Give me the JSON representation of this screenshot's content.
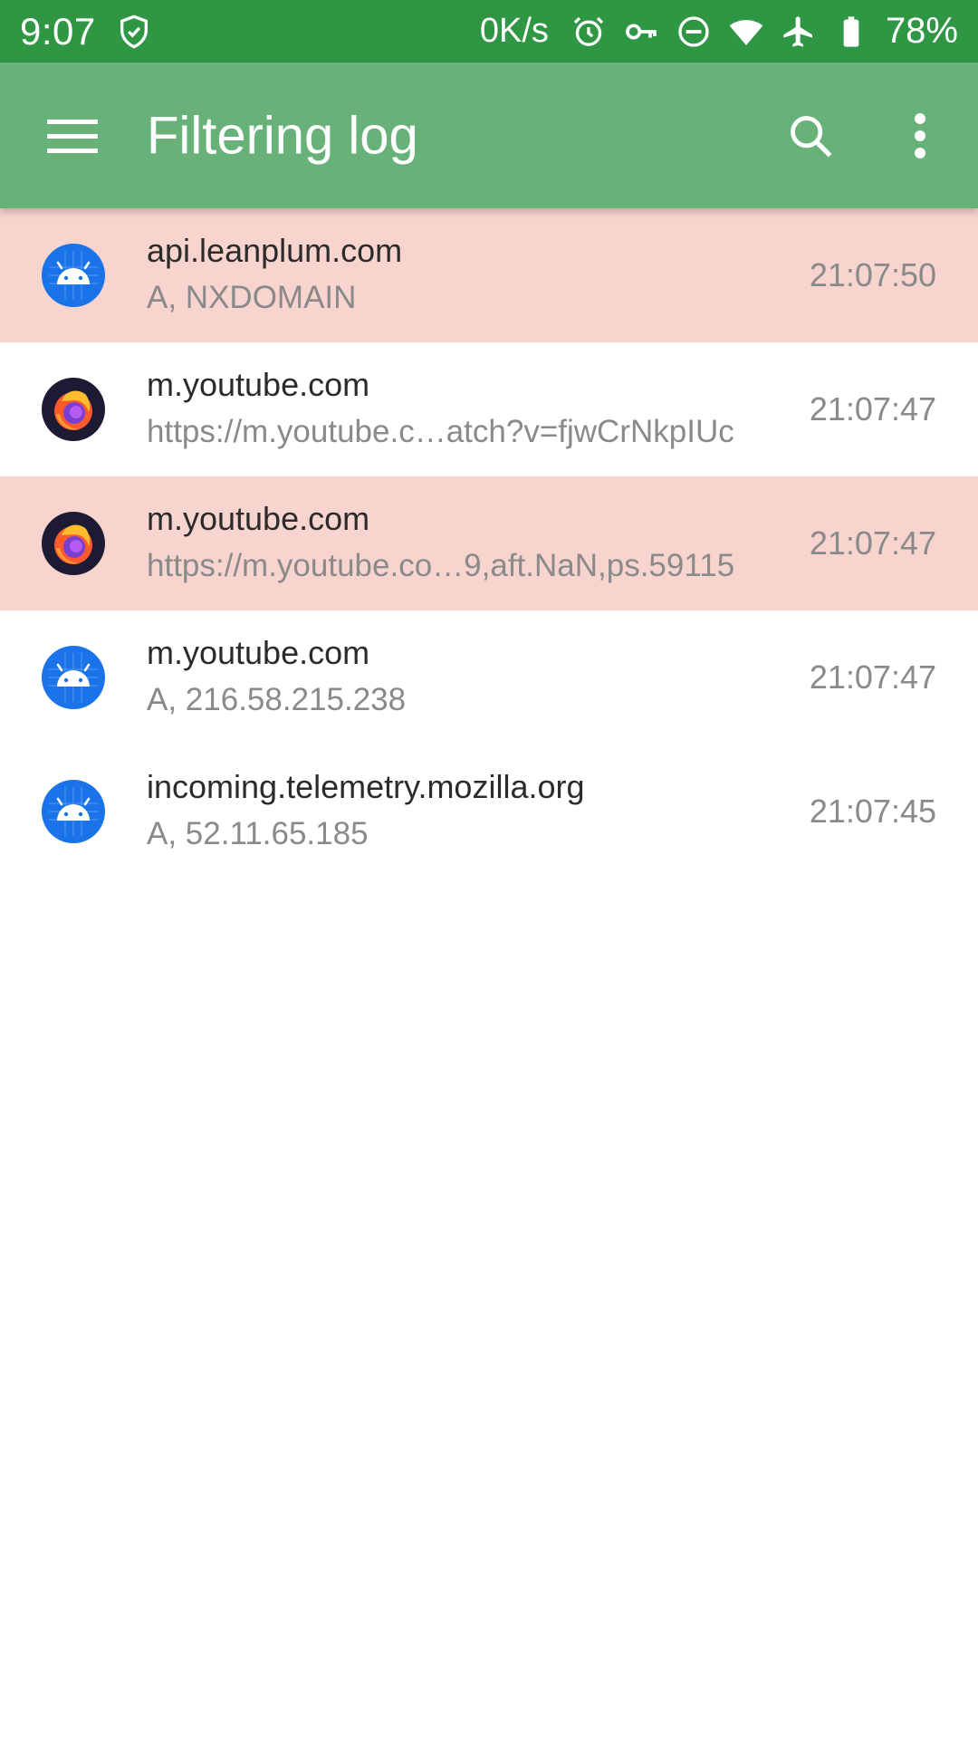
{
  "status_bar": {
    "time": "9:07",
    "speed": "0K/s",
    "battery": "78%",
    "icons": [
      "shield-check-icon",
      "alarm-icon",
      "vpn-key-icon",
      "do-not-disturb-icon",
      "wifi-icon",
      "airplane-icon",
      "battery-icon"
    ]
  },
  "app_bar": {
    "title": "Filtering log",
    "menu_icon": "hamburger-menu-icon",
    "search_icon": "search-icon",
    "overflow_icon": "more-vert-icon"
  },
  "colors": {
    "status_bar": "#2f9644",
    "app_bar": "#68b27a",
    "blocked_row": "#f8d4cf"
  },
  "log": [
    {
      "app": "android-icon",
      "host": "api.leanplum.com",
      "detail": "A, NXDOMAIN",
      "time": "21:07:50",
      "blocked": true
    },
    {
      "app": "firefox-icon",
      "host": "m.youtube.com",
      "detail": "https://m.youtube.c…atch?v=fjwCrNkpIUc",
      "time": "21:07:47",
      "blocked": false
    },
    {
      "app": "firefox-icon",
      "host": "m.youtube.com",
      "detail": "https://m.youtube.co…9,aft.NaN,ps.59115",
      "time": "21:07:47",
      "blocked": true
    },
    {
      "app": "android-icon",
      "host": "m.youtube.com",
      "detail": "A, 216.58.215.238",
      "time": "21:07:47",
      "blocked": false
    },
    {
      "app": "android-icon",
      "host": "incoming.telemetry.mozilla.org",
      "detail": "A, 52.11.65.185",
      "time": "21:07:45",
      "blocked": false
    }
  ]
}
